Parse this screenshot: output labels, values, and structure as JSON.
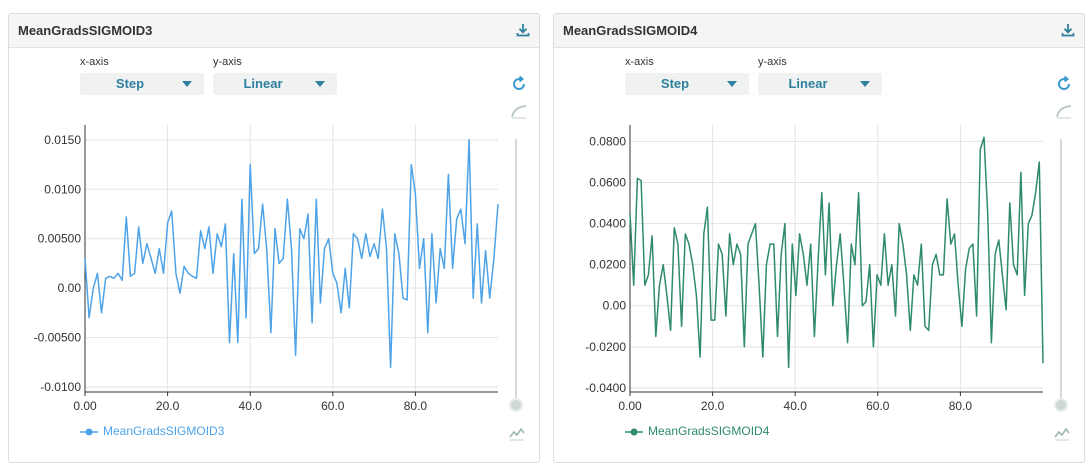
{
  "panels": [
    {
      "title": "MeanGradsSIGMOID3",
      "xaxis_label": "x-axis",
      "xaxis_value": "Step",
      "yaxis_label": "y-axis",
      "yaxis_value": "Linear",
      "legend": "MeanGradsSIGMOID3",
      "color": "#4ea3e8"
    },
    {
      "title": "MeanGradsSIGMOID4",
      "xaxis_label": "x-axis",
      "xaxis_value": "Step",
      "yaxis_label": "y-axis",
      "yaxis_value": "Linear",
      "legend": "MeanGradsSIGMOID4",
      "color": "#2e8b68"
    }
  ],
  "chart_data": [
    {
      "type": "line",
      "title": "MeanGradsSIGMOID3",
      "xlabel": "",
      "ylabel": "",
      "xlim": [
        0,
        100
      ],
      "ylim": [
        -0.0105,
        0.0165
      ],
      "x_ticks": [
        0,
        20,
        40,
        60,
        80
      ],
      "x_tick_labels": [
        "0.00",
        "20.0",
        "40.0",
        "60.0",
        "80.0"
      ],
      "y_ticks": [
        -0.01,
        -0.005,
        0,
        0.005,
        0.01,
        0.015
      ],
      "y_tick_labels": [
        "-0.0100",
        "-0.00500",
        "0.00",
        "0.00500",
        "0.0100",
        "0.0150"
      ],
      "grid": true,
      "legend_position": "bottom-left",
      "series": [
        {
          "name": "MeanGradsSIGMOID3",
          "color": "#4ea3e8",
          "values": [
            0.003,
            -0.003,
            0.0,
            0.0015,
            -0.0025,
            0.001,
            0.0012,
            0.001,
            0.0015,
            0.0008,
            0.0072,
            0.0012,
            0.0015,
            0.0062,
            0.0025,
            0.0045,
            0.003,
            0.0015,
            0.004,
            0.0015,
            0.0066,
            0.0078,
            0.0015,
            -0.0005,
            0.0022,
            0.0015,
            0.0012,
            0.001,
            0.0058,
            0.004,
            0.0062,
            0.0015,
            0.0055,
            0.0042,
            0.0065,
            -0.0055,
            0.0035,
            -0.0055,
            0.009,
            -0.003,
            0.0125,
            0.0035,
            0.004,
            0.0085,
            0.004,
            -0.0045,
            0.006,
            0.0025,
            0.003,
            0.009,
            0.004,
            -0.0068,
            0.006,
            0.005,
            0.0075,
            -0.0035,
            0.009,
            -0.0015,
            0.004,
            0.005,
            0.0015,
            0.0005,
            -0.0025,
            0.002,
            -0.002,
            0.0055,
            0.005,
            0.003,
            0.0055,
            0.0032,
            0.0045,
            0.003,
            0.008,
            0.004,
            -0.008,
            0.0055,
            0.0035,
            -0.001,
            -0.0012,
            0.0125,
            0.0095,
            0.002,
            0.005,
            -0.0045,
            0.0055,
            -0.0015,
            0.004,
            0.002,
            0.0115,
            0.002,
            0.007,
            0.008,
            0.0045,
            0.015,
            -0.001,
            0.0065,
            -0.0015,
            0.0038,
            -0.001,
            0.003,
            0.0085
          ]
        }
      ]
    },
    {
      "type": "line",
      "title": "MeanGradsSIGMOID4",
      "xlabel": "",
      "ylabel": "",
      "xlim": [
        0,
        100
      ],
      "ylim": [
        -0.042,
        0.088
      ],
      "x_ticks": [
        0,
        20,
        40,
        60,
        80
      ],
      "x_tick_labels": [
        "0.00",
        "20.0",
        "40.0",
        "60.0",
        "80.0"
      ],
      "y_ticks": [
        -0.04,
        -0.02,
        0,
        0.02,
        0.04,
        0.06,
        0.08
      ],
      "y_tick_labels": [
        "-0.0400",
        "-0.0200",
        "0.00",
        "0.0200",
        "0.0400",
        "0.0600",
        "0.0800"
      ],
      "grid": true,
      "legend_position": "bottom-left",
      "series": [
        {
          "name": "MeanGradsSIGMOID4",
          "color": "#2e8b68",
          "values": [
            0.045,
            0.01,
            0.062,
            0.061,
            0.01,
            0.015,
            0.034,
            -0.015,
            0.01,
            0.02,
            0.005,
            -0.012,
            0.038,
            0.03,
            -0.01,
            0.035,
            0.03,
            0.02,
            0.005,
            -0.025,
            0.035,
            0.048,
            -0.007,
            -0.007,
            0.03,
            0.025,
            -0.005,
            0.035,
            0.02,
            0.03,
            0.025,
            -0.02,
            0.03,
            0.035,
            0.04,
            0.01,
            -0.025,
            0.02,
            0.03,
            0.03,
            -0.015,
            0.025,
            0.04,
            -0.03,
            0.03,
            0.005,
            0.035,
            0.025,
            0.01,
            0.03,
            -0.015,
            0.022,
            0.055,
            0.015,
            0.05,
            0.0,
            0.02,
            0.035,
            0.01,
            -0.018,
            0.03,
            0.02,
            0.055,
            0.0,
            0.002,
            0.02,
            -0.02,
            0.015,
            0.01,
            0.035,
            0.01,
            0.02,
            -0.005,
            0.04,
            0.03,
            0.015,
            -0.012,
            0.015,
            0.01,
            0.03,
            -0.01,
            -0.012,
            0.02,
            0.025,
            0.015,
            0.015,
            0.052,
            0.03,
            0.035,
            0.01,
            -0.01,
            0.018,
            0.028,
            0.03,
            -0.005,
            0.076,
            0.082,
            0.045,
            -0.018,
            0.025,
            0.032,
            0.015,
            -0.002,
            0.05,
            0.02,
            0.015,
            0.065,
            0.005,
            0.04,
            0.044,
            0.055,
            0.07,
            -0.028
          ]
        }
      ]
    }
  ]
}
